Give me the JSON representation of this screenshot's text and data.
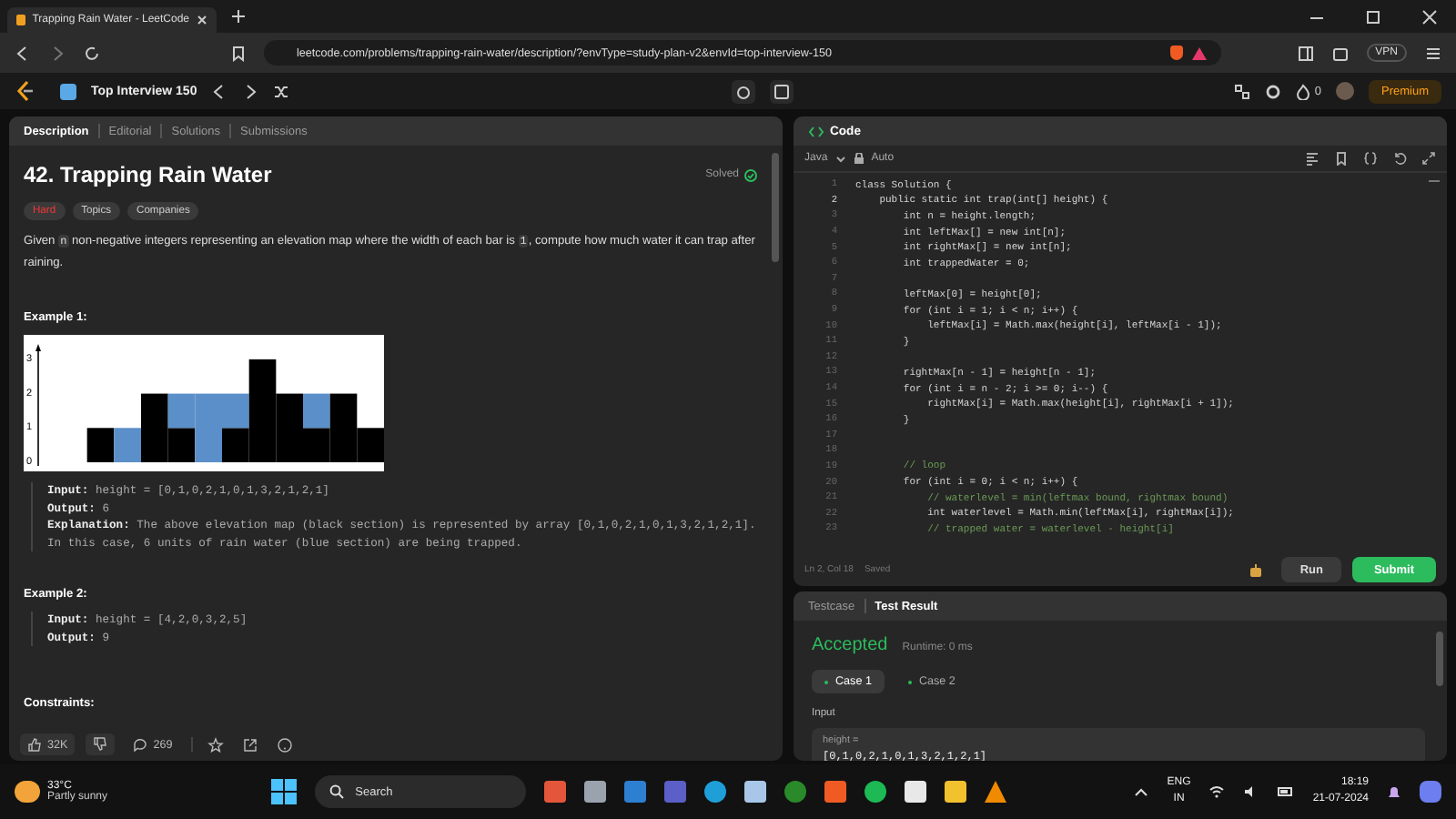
{
  "browser": {
    "tab_title": "Trapping Rain Water - LeetCode",
    "url": "leetcode.com/problems/trapping-rain-water/description/?envType=study-plan-v2&envId=top-interview-150",
    "vpn": "VPN"
  },
  "topbar": {
    "study_plan": "Top Interview 150",
    "streak": "0",
    "premium": "Premium"
  },
  "left_tabs": [
    {
      "label": "Description",
      "selected": true
    },
    {
      "label": "Editorial",
      "selected": false
    },
    {
      "label": "Solutions",
      "selected": false
    },
    {
      "label": "Submissions",
      "selected": false
    }
  ],
  "problem": {
    "title": "42. Trapping Rain Water",
    "status": "Solved",
    "difficulty": "Hard",
    "tags": [
      "Topics",
      "Companies"
    ],
    "description": [
      {
        "kind": "text",
        "text": "Given "
      },
      {
        "kind": "code",
        "text": "n"
      },
      {
        "kind": "text",
        "text": " non-negative integers representing an elevation map where the width of each bar is "
      },
      {
        "kind": "code",
        "text": "1"
      },
      {
        "kind": "text",
        "text": ", compute how much water it can trap after raining."
      }
    ]
  },
  "examples": [
    {
      "heading": "Example 1:",
      "figure": {
        "axis_labels": [
          "3",
          "2",
          "1",
          "0"
        ]
      },
      "lines": [
        {
          "label": "Input:",
          "value": "height = [0,1,0,2,1,0,1,3,2,1,2,1]"
        },
        {
          "label": "Output:",
          "value": "6"
        },
        {
          "label": "Explanation:",
          "value": "The above elevation map (black section) is represented by array [0,1,0,2,1,0,1,3,2,1,2,1]. In this case, 6 units of rain water (blue section) are being trapped."
        }
      ]
    },
    {
      "heading": "Example 2:",
      "lines": [
        {
          "label": "Input:",
          "value": "height = [4,2,0,3,2,5]"
        },
        {
          "label": "Output:",
          "value": "9"
        }
      ]
    }
  ],
  "constraints_heading": "Constraints:",
  "footer": {
    "likes": "32K",
    "comments": "269"
  },
  "code": {
    "title": "Code",
    "language": "Java",
    "mode": "Auto",
    "position": "Ln 2, Col 18",
    "save_state": "Saved",
    "run": "Run",
    "submit": "Submit",
    "lines": [
      {
        "n": "1",
        "active": false,
        "kind": "code",
        "text": "class Solution {"
      },
      {
        "n": "2",
        "active": true,
        "kind": "code",
        "text": "    public static int trap(int[] height) {"
      },
      {
        "n": "3",
        "active": false,
        "kind": "code",
        "text": "        int n = height.length;"
      },
      {
        "n": "4",
        "active": false,
        "kind": "code",
        "text": "        int leftMax[] = new int[n];"
      },
      {
        "n": "5",
        "active": false,
        "kind": "code",
        "text": "        int rightMax[] = new int[n];"
      },
      {
        "n": "6",
        "active": false,
        "kind": "code",
        "text": "        int trappedWater = 0;"
      },
      {
        "n": "7",
        "active": false,
        "kind": "blank"
      },
      {
        "n": "8",
        "active": false,
        "kind": "code",
        "text": "        leftMax[0] = height[0];"
      },
      {
        "n": "9",
        "active": false,
        "kind": "code",
        "text": "        for (int i = 1; i < n; i++) {"
      },
      {
        "n": "10",
        "active": false,
        "kind": "code",
        "text": "            leftMax[i] = Math.max(height[i], leftMax[i - 1]);"
      },
      {
        "n": "11",
        "active": false,
        "kind": "code",
        "text": "        }"
      },
      {
        "n": "12",
        "active": false,
        "kind": "blank"
      },
      {
        "n": "13",
        "active": false,
        "kind": "code",
        "text": "        rightMax[n - 1] = height[n - 1];"
      },
      {
        "n": "14",
        "active": false,
        "kind": "code",
        "text": "        for (int i = n - 2; i >= 0; i--) {"
      },
      {
        "n": "15",
        "active": false,
        "kind": "code",
        "text": "            rightMax[i] = Math.max(height[i], rightMax[i + 1]);"
      },
      {
        "n": "16",
        "active": false,
        "kind": "code",
        "text": "        }"
      },
      {
        "n": "17",
        "active": false,
        "kind": "blank"
      },
      {
        "n": "18",
        "active": false,
        "kind": "blank"
      },
      {
        "n": "19",
        "active": false,
        "kind": "comment",
        "text": "        // loop"
      },
      {
        "n": "20",
        "active": false,
        "kind": "code",
        "text": "        for (int i = 0; i < n; i++) {"
      },
      {
        "n": "21",
        "active": false,
        "kind": "comment",
        "text": "            // waterlevel = min(leftmax bound, rightmax bound)"
      },
      {
        "n": "22",
        "active": false,
        "kind": "code",
        "text": "            int waterlevel = Math.min(leftMax[i], rightMax[i]);"
      },
      {
        "n": "23",
        "active": false,
        "kind": "comment",
        "text": "            // trapped water = waterlevel - height[i]"
      }
    ]
  },
  "test": {
    "tabs": [
      {
        "label": "Testcase",
        "selected": false
      },
      {
        "label": "Test Result",
        "selected": true
      }
    ],
    "verdict": "Accepted",
    "runtime": "Runtime: 0 ms",
    "cases": [
      {
        "label": "Case 1",
        "selected": true
      },
      {
        "label": "Case 2",
        "selected": false
      }
    ],
    "input_label": "Input",
    "param": "height =",
    "value": "[0,1,0,2,1,0,1,3,2,1,2,1]"
  },
  "taskbar": {
    "temp": "33°C",
    "weather": "Partly sunny",
    "search": "Search",
    "lang": "ENG",
    "region": "IN",
    "time": "18:19",
    "date": "21-07-2024"
  }
}
